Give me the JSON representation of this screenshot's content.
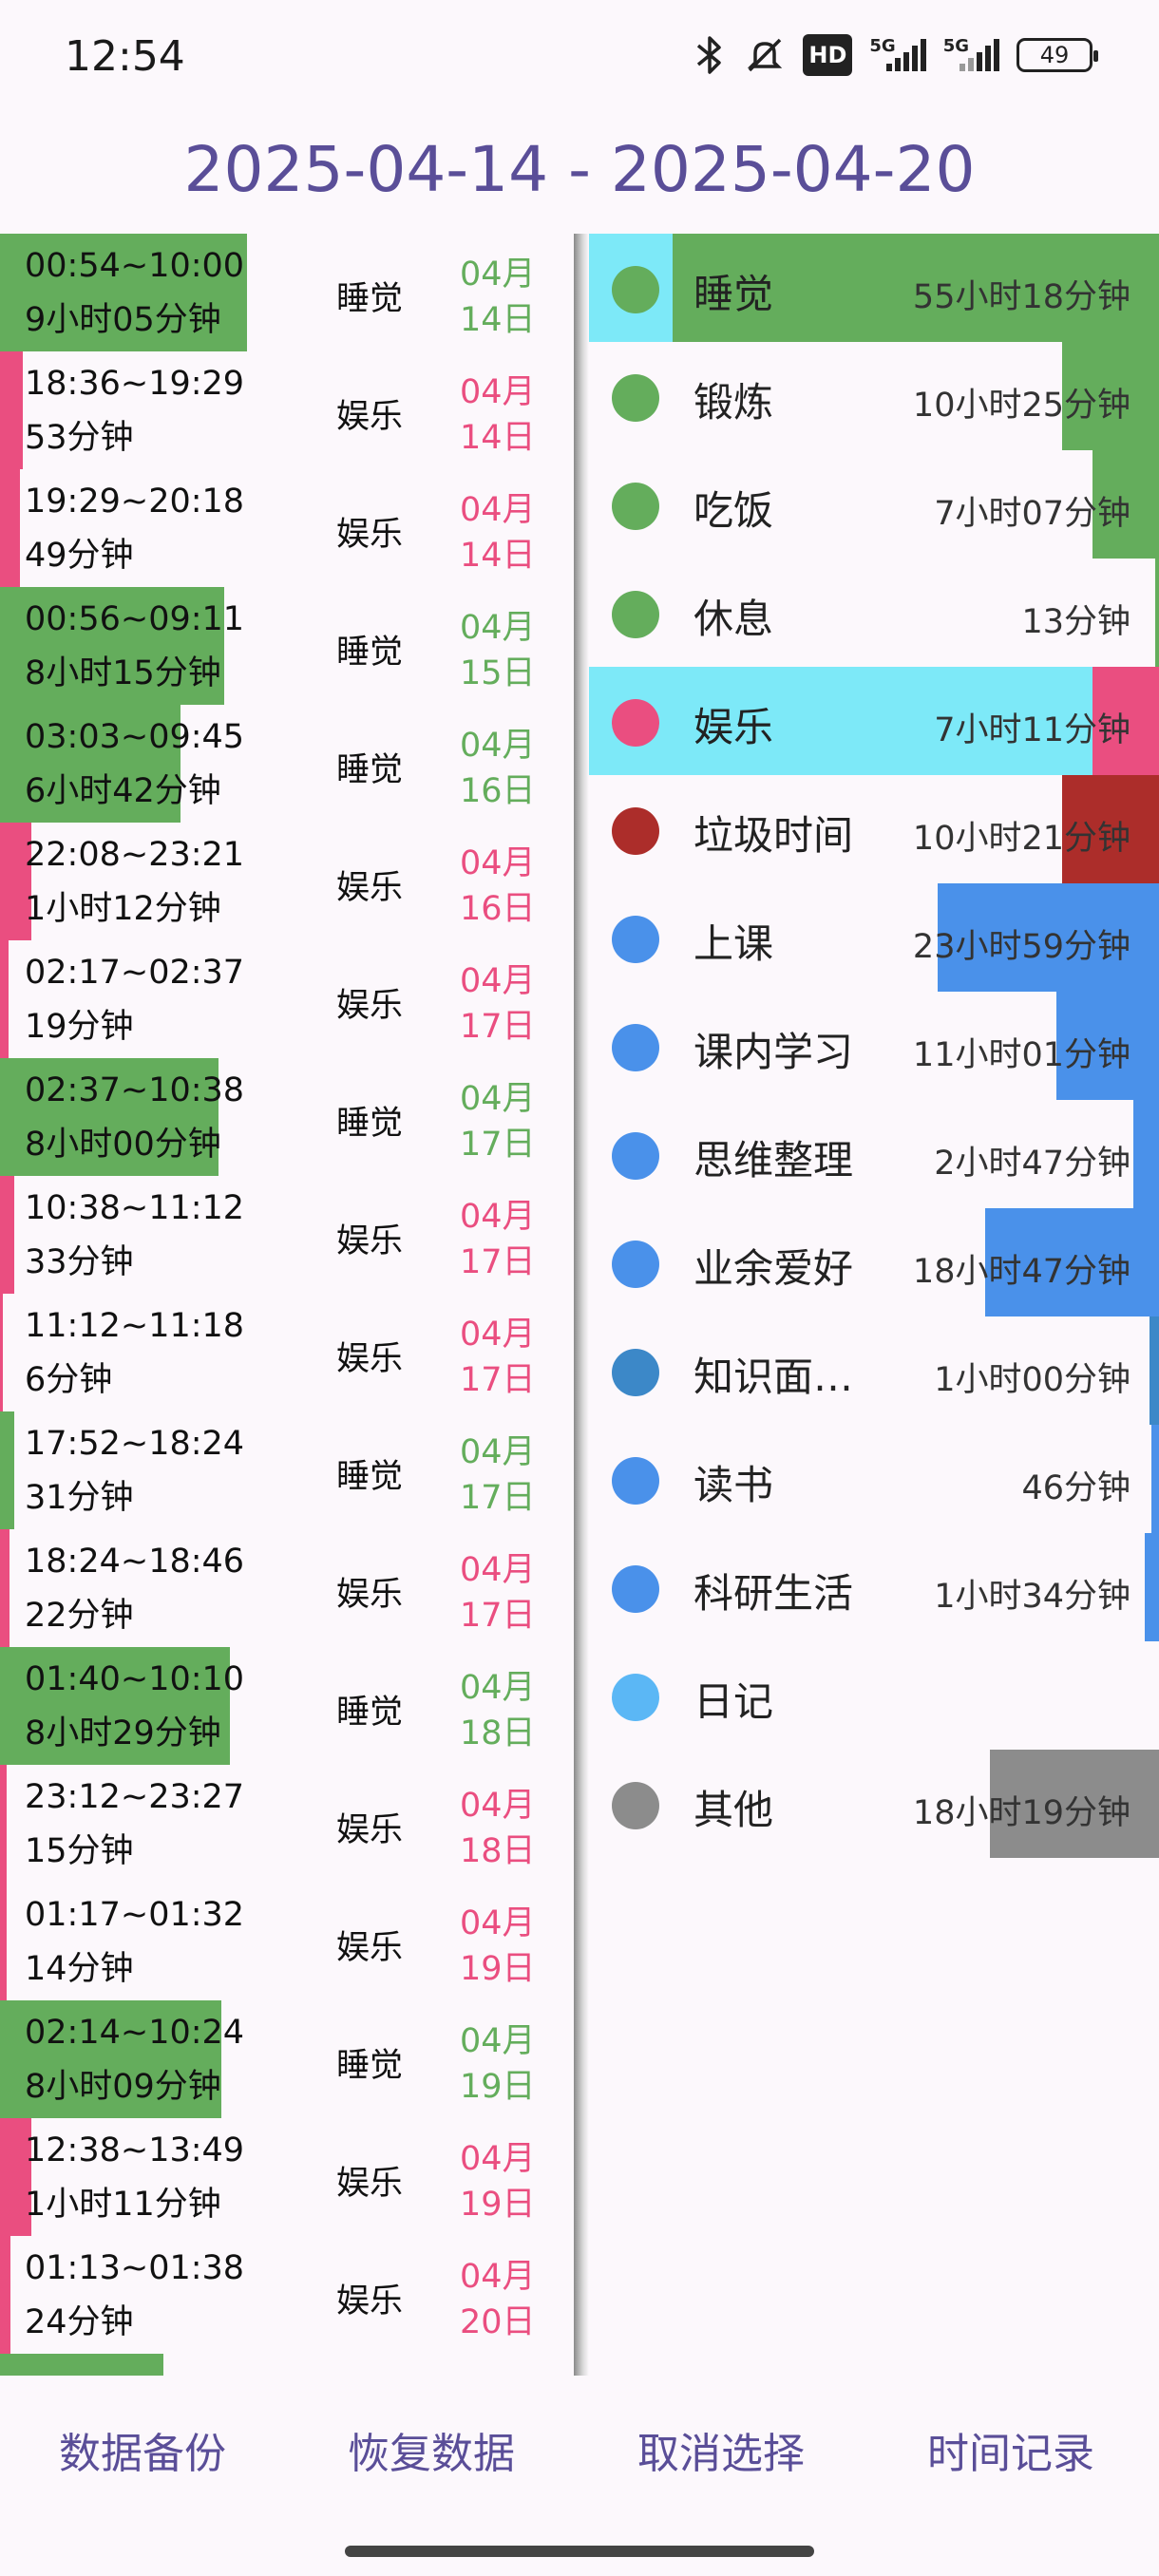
{
  "status_bar": {
    "time": "12:54",
    "icons": [
      "bluetooth-icon",
      "mute-icon",
      "hd-icon",
      "signal-5g-icon",
      "signal-5g-icon",
      "battery-icon"
    ],
    "hd": "HD",
    "net1": "5G",
    "net2": "5G",
    "battery": "49"
  },
  "header": {
    "date_range": "2025-04-14 - 2025-04-20"
  },
  "colors": {
    "sleep": "#64ad5c",
    "entertainment": "#ea4e80",
    "cyan_highlight": "#7de9f8",
    "garbage": "#ac2d2a",
    "blue": "#4a91ea",
    "other": "#8c8c8c",
    "title": "#5a4e98"
  },
  "records": [
    {
      "range": "00:54~10:00",
      "duration": " 9小时05分钟",
      "category": "睡觉",
      "month": "04月",
      "day": "14日",
      "kind": "sleep",
      "fill": 0.43
    },
    {
      "range": "18:36~19:29",
      "duration": "53分钟",
      "category": "娱乐",
      "month": "04月",
      "day": "14日",
      "kind": "entertainment",
      "fill": 0.04
    },
    {
      "range": "19:29~20:18",
      "duration": "49分钟",
      "category": "娱乐",
      "month": "04月",
      "day": "14日",
      "kind": "entertainment",
      "fill": 0.035
    },
    {
      "range": "00:56~09:11",
      "duration": " 8小时15分钟",
      "category": "睡觉",
      "month": "04月",
      "day": "15日",
      "kind": "sleep",
      "fill": 0.39
    },
    {
      "range": "03:03~09:45",
      "duration": " 6小时42分钟",
      "category": "睡觉",
      "month": "04月",
      "day": "16日",
      "kind": "sleep",
      "fill": 0.315
    },
    {
      "range": "22:08~23:21",
      "duration": " 1小时12分钟",
      "category": "娱乐",
      "month": "04月",
      "day": "16日",
      "kind": "entertainment",
      "fill": 0.055
    },
    {
      "range": "02:17~02:37",
      "duration": "19分钟",
      "category": "娱乐",
      "month": "04月",
      "day": "17日",
      "kind": "entertainment",
      "fill": 0.015
    },
    {
      "range": "02:37~10:38",
      "duration": " 8小时00分钟",
      "category": "睡觉",
      "month": "04月",
      "day": "17日",
      "kind": "sleep",
      "fill": 0.38
    },
    {
      "range": "10:38~11:12",
      "duration": "33分钟",
      "category": "娱乐",
      "month": "04月",
      "day": "17日",
      "kind": "entertainment",
      "fill": 0.025
    },
    {
      "range": "11:12~11:18",
      "duration": " 6分钟",
      "category": "娱乐",
      "month": "04月",
      "day": "17日",
      "kind": "entertainment",
      "fill": 0.005
    },
    {
      "range": "17:52~18:24",
      "duration": "31分钟",
      "category": "睡觉",
      "month": "04月",
      "day": "17日",
      "kind": "sleep",
      "fill": 0.025
    },
    {
      "range": "18:24~18:46",
      "duration": "22分钟",
      "category": "娱乐",
      "month": "04月",
      "day": "17日",
      "kind": "entertainment",
      "fill": 0.017
    },
    {
      "range": "01:40~10:10",
      "duration": " 8小时29分钟",
      "category": "睡觉",
      "month": "04月",
      "day": "18日",
      "kind": "sleep",
      "fill": 0.4
    },
    {
      "range": "23:12~23:27",
      "duration": "15分钟",
      "category": "娱乐",
      "month": "04月",
      "day": "18日",
      "kind": "entertainment",
      "fill": 0.012
    },
    {
      "range": "01:17~01:32",
      "duration": "14分钟",
      "category": "娱乐",
      "month": "04月",
      "day": "19日",
      "kind": "entertainment",
      "fill": 0.011
    },
    {
      "range": "02:14~10:24",
      "duration": " 8小时09分钟",
      "category": "睡觉",
      "month": "04月",
      "day": "19日",
      "kind": "sleep",
      "fill": 0.385
    },
    {
      "range": "12:38~13:49",
      "duration": " 1小时11分钟",
      "category": "娱乐",
      "month": "04月",
      "day": "19日",
      "kind": "entertainment",
      "fill": 0.055
    },
    {
      "range": "01:13~01:38",
      "duration": "24分钟",
      "category": "娱乐",
      "month": "04月",
      "day": "20日",
      "kind": "entertainment",
      "fill": 0.019
    },
    {
      "range": "",
      "duration": "",
      "category": "",
      "month": "",
      "day": "",
      "kind": "sleep",
      "fill": 0.285
    }
  ],
  "stats": [
    {
      "name": "睡觉",
      "total": "55小时18分钟",
      "dot": "#64ad5c",
      "fill_color": "#64ad5c",
      "fill": 1.0,
      "highlight": true
    },
    {
      "name": "锻炼",
      "total": "10小时25分钟",
      "dot": "#64ad5c",
      "fill_color": "#64ad5c",
      "fill": 0.19,
      "highlight": false
    },
    {
      "name": "吃饭",
      "total": "7小时07分钟",
      "dot": "#64ad5c",
      "fill_color": "#64ad5c",
      "fill": 0.13,
      "highlight": false
    },
    {
      "name": "休息",
      "total": "13分钟",
      "dot": "#64ad5c",
      "fill_color": "#64ad5c",
      "fill": 0.004,
      "highlight": false
    },
    {
      "name": "娱乐",
      "total": "7小时11分钟",
      "dot": "#ea4e80",
      "fill_color": "#ea4e80",
      "fill": 0.13,
      "highlight": true
    },
    {
      "name": "垃圾时间",
      "total": "10小时21分钟",
      "dot": "#ac2d2a",
      "fill_color": "#ac2d2a",
      "fill": 0.19,
      "highlight": false
    },
    {
      "name": "上课",
      "total": "23小时59分钟",
      "dot": "#4a91ea",
      "fill_color": "#4a91ea",
      "fill": 0.434,
      "highlight": false
    },
    {
      "name": "课内学习",
      "total": "11小时01分钟",
      "dot": "#4a91ea",
      "fill_color": "#4a91ea",
      "fill": 0.2,
      "highlight": false
    },
    {
      "name": "思维整理",
      "total": "2小时47分钟",
      "dot": "#4a91ea",
      "fill_color": "#4a91ea",
      "fill": 0.05,
      "highlight": false
    },
    {
      "name": "业余爱好",
      "total": "18小时47分钟",
      "dot": "#4a91ea",
      "fill_color": "#4a91ea",
      "fill": 0.34,
      "highlight": false
    },
    {
      "name": "知识面…",
      "total": "1小时00分钟",
      "dot": "#3c88c8",
      "fill_color": "#3c88c8",
      "fill": 0.018,
      "highlight": false
    },
    {
      "name": "读书",
      "total": "46分钟",
      "dot": "#4a91ea",
      "fill_color": "#4a91ea",
      "fill": 0.014,
      "highlight": false
    },
    {
      "name": "科研生活",
      "total": "1小时34分钟",
      "dot": "#4a91ea",
      "fill_color": "#4a91ea",
      "fill": 0.028,
      "highlight": false
    },
    {
      "name": "日记",
      "total": "",
      "dot": "#5bb7f5",
      "fill_color": "#5bb7f5",
      "fill": 0.0,
      "highlight": false
    },
    {
      "name": "其他",
      "total": "18小时19分钟",
      "dot": "#8c8c8c",
      "fill_color": "#8c8c8c",
      "fill": 0.331,
      "highlight": false
    }
  ],
  "bottom_nav": {
    "backup": "数据备份",
    "restore": "恢复数据",
    "deselect": "取消选择",
    "time_record": "时间记录"
  }
}
